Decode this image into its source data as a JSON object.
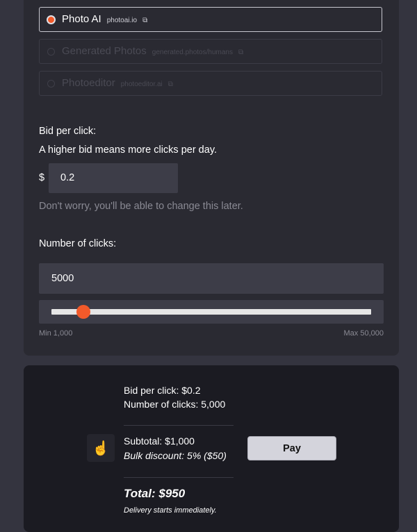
{
  "sites": [
    {
      "name": "Photo AI",
      "url": "photoai.io",
      "selected": true
    },
    {
      "name": "Generated Photos",
      "url": "generated.photos/humans",
      "selected": false
    },
    {
      "name": "Photoeditor",
      "url": "photoeditor.ai",
      "selected": false
    }
  ],
  "bid": {
    "label": "Bid per click:",
    "hint": "A higher bid means more clicks per day.",
    "currency_symbol": "$",
    "value": "0.2",
    "note": "Don't worry, you'll be able to change this later."
  },
  "clicks": {
    "label": "Number of clicks:",
    "value": "5000",
    "slider_fraction": 0.0816,
    "min_label": "Min 1,000",
    "max_label": "Max 50,000"
  },
  "summary": {
    "bid_line": "Bid per click: $0.2",
    "clicks_line": "Number of clicks: 5,000",
    "subtotal": "Subtotal: $1,000",
    "discount": "Bulk discount: 5% ($50)",
    "total": "Total: $950",
    "delivery": "Delivery starts immediately.",
    "pay_label": "Pay",
    "cursor_icon": "pointer-hand-icon"
  },
  "colors": {
    "accent": "#f25a2a",
    "panel": "#2a2a32",
    "summary_panel": "#1b1b22"
  }
}
